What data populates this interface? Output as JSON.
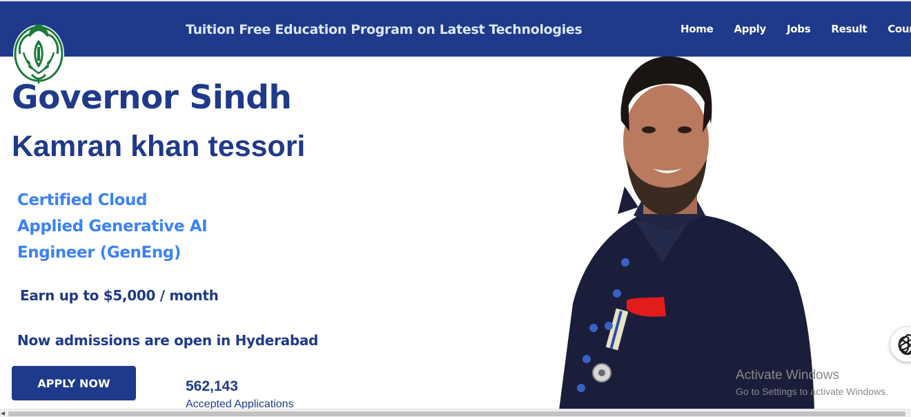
{
  "header": {
    "title": "Tuition Free Education Program on Latest Technologies",
    "nav": [
      "Home",
      "Apply",
      "Jobs",
      "Result",
      "Courses"
    ]
  },
  "hero": {
    "heading": "Governor Sindh",
    "name": "Kamran khan tessori",
    "courses": [
      "Certified Cloud",
      "Applied Generative AI",
      "Engineer (GenEng)"
    ],
    "earn": "Earn up to $5,000 / month",
    "admissions": "Now admissions are open in Hyderabad",
    "apply_button": "APPLY NOW",
    "stat_value": "562,143",
    "stat_label": "Accepted Applications"
  },
  "watermark": {
    "title": "Activate Windows",
    "subtitle": "Go to Settings to activate Windows."
  },
  "icons": {
    "logo": "governor-house-emblem-icon",
    "chat": "chat-widget-icon",
    "scroll_left": "scroll-left-arrow-icon"
  },
  "colors": {
    "navbar": "#1f3a8a",
    "heading": "#1f3a8a",
    "courses": "#3b82f6",
    "button": "#1f3a8a",
    "emblem": "#1b7a3a"
  }
}
